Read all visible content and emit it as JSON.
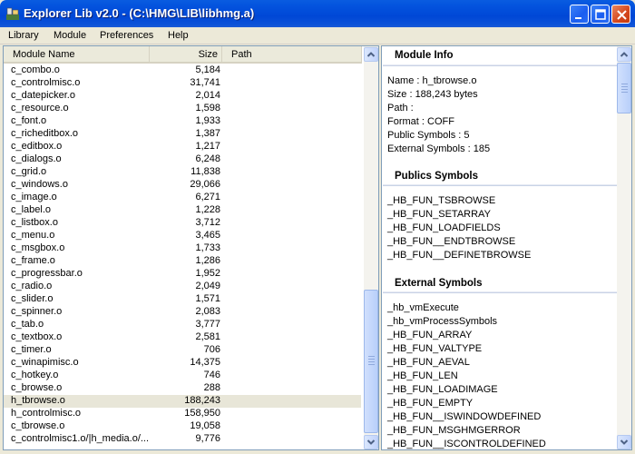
{
  "window": {
    "title": "Explorer Lib v2.0 - (C:\\HMG\\LIB\\libhmg.a)"
  },
  "menu": [
    "Library",
    "Module",
    "Preferences",
    "Help"
  ],
  "list": {
    "columns": {
      "name": "Module Name",
      "size": "Size",
      "path": "Path"
    },
    "rows": [
      {
        "name": "c_combo.o",
        "size": "5,184"
      },
      {
        "name": "c_controlmisc.o",
        "size": "31,741"
      },
      {
        "name": "c_datepicker.o",
        "size": "2,014"
      },
      {
        "name": "c_resource.o",
        "size": "1,598"
      },
      {
        "name": "c_font.o",
        "size": "1,933"
      },
      {
        "name": "c_richeditbox.o",
        "size": "1,387"
      },
      {
        "name": "c_editbox.o",
        "size": "1,217"
      },
      {
        "name": "c_dialogs.o",
        "size": "6,248"
      },
      {
        "name": "c_grid.o",
        "size": "11,838"
      },
      {
        "name": "c_windows.o",
        "size": "29,066"
      },
      {
        "name": "c_image.o",
        "size": "6,271"
      },
      {
        "name": "c_label.o",
        "size": "1,228"
      },
      {
        "name": "c_listbox.o",
        "size": "3,712"
      },
      {
        "name": "c_menu.o",
        "size": "3,465"
      },
      {
        "name": "c_msgbox.o",
        "size": "1,733"
      },
      {
        "name": "c_frame.o",
        "size": "1,286"
      },
      {
        "name": "c_progressbar.o",
        "size": "1,952"
      },
      {
        "name": "c_radio.o",
        "size": "2,049"
      },
      {
        "name": "c_slider.o",
        "size": "1,571"
      },
      {
        "name": "c_spinner.o",
        "size": "2,083"
      },
      {
        "name": "c_tab.o",
        "size": "3,777"
      },
      {
        "name": "c_textbox.o",
        "size": "2,581"
      },
      {
        "name": "c_timer.o",
        "size": "706"
      },
      {
        "name": "c_winapimisc.o",
        "size": "14,375"
      },
      {
        "name": "c_hotkey.o",
        "size": "746"
      },
      {
        "name": "c_browse.o",
        "size": "288"
      },
      {
        "name": "h_tbrowse.o",
        "size": "188,243",
        "selected": true
      },
      {
        "name": "h_controlmisc.o",
        "size": "158,950"
      },
      {
        "name": "c_tbrowse.o",
        "size": "19,058"
      },
      {
        "name": "c_controlmisc1.o/|h_media.o/...",
        "size": "9,776"
      }
    ]
  },
  "info": {
    "module_info_title": "Module Info",
    "name_line": "Name : h_tbrowse.o",
    "size_line": "Size : 188,243 bytes",
    "path_line": "Path :",
    "format_line": "Format : COFF",
    "public_line": "Public Symbols :     5",
    "external_line": "External Symbols :    185",
    "publics_title": "Publics Symbols",
    "publics": [
      "_HB_FUN_TSBROWSE",
      "_HB_FUN_SETARRAY",
      "_HB_FUN_LOADFIELDS",
      "_HB_FUN__ENDTBROWSE",
      "_HB_FUN__DEFINETBROWSE"
    ],
    "external_title": "External Symbols",
    "externals": [
      "_hb_vmExecute",
      "_hb_vmProcessSymbols",
      "_HB_FUN_ARRAY",
      "_HB_FUN_VALTYPE",
      "_HB_FUN_AEVAL",
      "_HB_FUN_LEN",
      "_HB_FUN_LOADIMAGE",
      "_HB_FUN_EMPTY",
      "_HB_FUN__ISWINDOWDEFINED",
      "_HB_FUN_MSGHMGERROR",
      "_HB_FUN__ISCONTROLDEFINED"
    ]
  },
  "colors": {
    "titlebar": "#0047d6",
    "selected_row": "#e8e6d8",
    "scroll_arrow": "#c1d3fb"
  }
}
